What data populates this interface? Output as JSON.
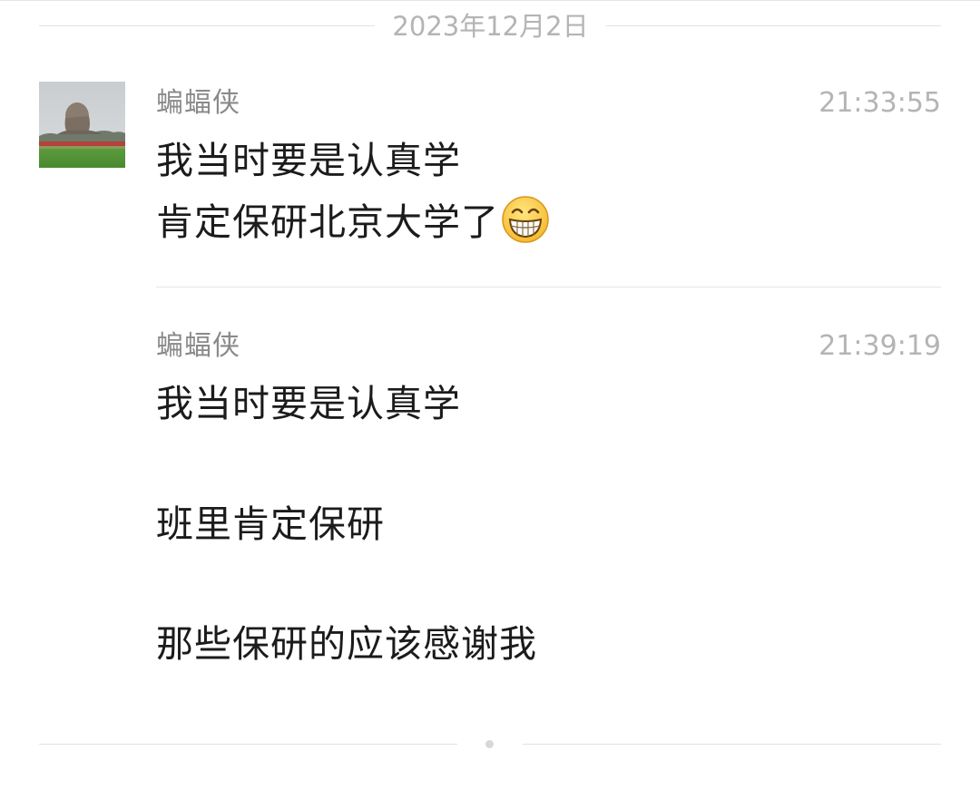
{
  "date_separator": "2023年12月2日",
  "messages": [
    {
      "sender": "蝙蝠侠",
      "time": "21:33:55",
      "lines": [
        "我当时要是认真学",
        "肯定保研北京大学了"
      ],
      "emoji": "grinning-face-emoji"
    },
    {
      "sender": "蝙蝠侠",
      "time": "21:39:19",
      "lines": [
        "我当时要是认真学",
        "班里肯定保研",
        "那些保研的应该感谢我"
      ]
    }
  ],
  "colors": {
    "background": "#ffffff",
    "sender_text": "#8a8a8a",
    "time_text": "#b4b4b4",
    "message_text": "#1b1b1b",
    "divider": "#e4e4e4"
  }
}
